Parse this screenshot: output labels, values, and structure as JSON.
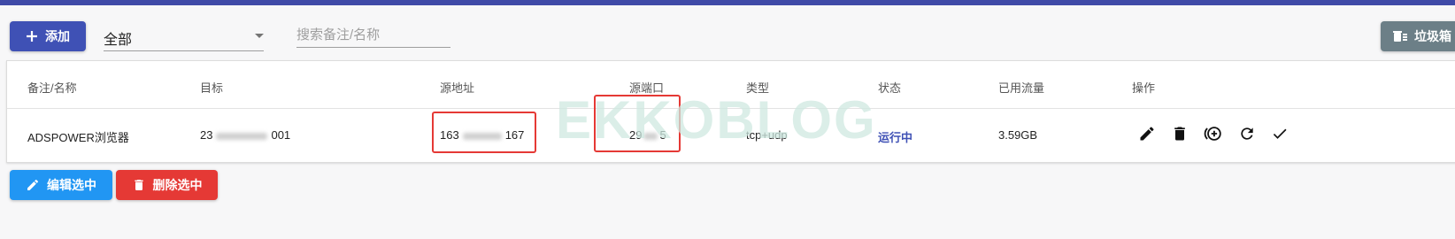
{
  "toolbar": {
    "add_label": "添加",
    "filter_value": "全部",
    "search_placeholder": "搜索备注/名称",
    "trash_label": "垃圾箱"
  },
  "table": {
    "headers": [
      "备注/名称",
      "目标",
      "源地址",
      "源端口",
      "类型",
      "状态",
      "已用流量",
      "操作"
    ],
    "rows": [
      {
        "name": "ADSPOWER浏览器",
        "target_prefix": "23",
        "target_suffix": "001",
        "source_prefix": "163",
        "source_suffix": "167",
        "port_prefix": "29",
        "port_suffix": "5",
        "type": "tcp+udp",
        "status": "运行中",
        "traffic": "3.59GB"
      }
    ]
  },
  "bulk": {
    "edit_label": "编辑选中",
    "delete_label": "删除选中"
  },
  "watermark": "EKKOBLOG",
  "colors": {
    "primary": "#3f51b5",
    "topbar": "#3f4aa7",
    "edit_selected": "#2196f3",
    "delete_selected": "#e53935",
    "trash": "#6c7f87",
    "highlight_box": "#e53935"
  },
  "icons": {
    "add": "plus-icon",
    "trash": "trash-list-icon",
    "edit": "pencil-icon",
    "delete": "trash-icon",
    "copy": "add-circle-icon",
    "refresh": "refresh-icon",
    "check": "check-icon"
  }
}
